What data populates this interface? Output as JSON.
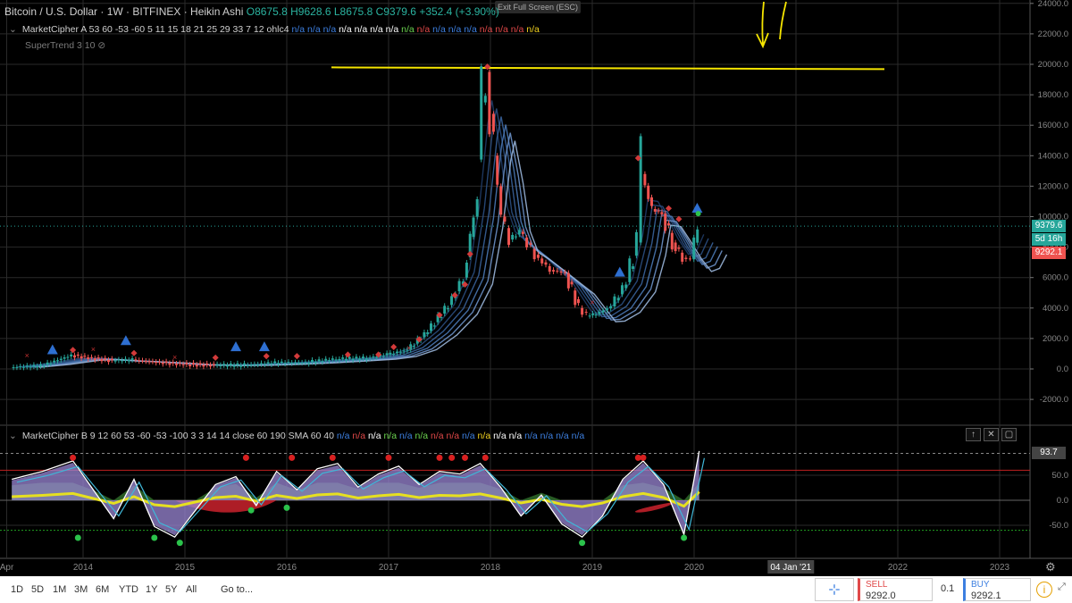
{
  "header": {
    "symbol": "Bitcoin / U.S. Dollar · 1W · BITFINEX · Heikin Ashi",
    "open": "O8675.8",
    "high": "H9628.6",
    "low": "L8675.8",
    "close": "C9379.6",
    "change": "+352.4 (+3.90%)",
    "exit_fullscreen": "Exit Full Screen (ESC)"
  },
  "indicators": {
    "a_label": "MarketCipher A 53 60 -53 -60 5 11 15 18 21 25 29 33 7 12 ohlc4",
    "a_values": [
      "n/a",
      "n/a",
      "n/a",
      "n/a",
      "n/a",
      "n/a",
      "n/a",
      "n/a",
      "n/a",
      "n/a",
      "n/a",
      "n/a",
      "n/a",
      "n/a",
      "n/a",
      "n/a"
    ],
    "a_value_colors": [
      "b",
      "b",
      "b",
      "w",
      "w",
      "w",
      "w",
      "g",
      "r",
      "b",
      "b",
      "b",
      "r",
      "r",
      "r",
      "y"
    ],
    "supertrend_label": "SuperTrend 3 10",
    "b_label": "MarketCipher B 9 12 60 53 -60 -53 -100 3 3 14 14 close 60 190 SMA 60 40",
    "b_values": [
      "n/a",
      "n/a",
      "n/a",
      "n/a",
      "n/a",
      "n/a",
      "n/a",
      "n/a",
      "n/a",
      "n/a",
      "n/a",
      "n/a",
      "n/a",
      "n/a",
      "n/a",
      "n/a"
    ],
    "b_value_colors": [
      "b",
      "r",
      "w",
      "g",
      "b",
      "g",
      "r",
      "r",
      "b",
      "y",
      "w",
      "w",
      "b",
      "b",
      "b",
      "b"
    ]
  },
  "price_tags": {
    "close": "9379.6",
    "countdown": "5d 16h",
    "bid": "9292.1",
    "osc_value": "93.7",
    "close_color": "#26a69a",
    "countdown_color": "#26a69a",
    "bid_color": "#ef5350"
  },
  "x_axis": {
    "years": [
      "Apr",
      "2014",
      "2015",
      "2016",
      "2017",
      "2018",
      "2019",
      "2020",
      "2021",
      "2022",
      "2023"
    ],
    "cursor_label": "04 Jan '21"
  },
  "timeframes": [
    "1D",
    "5D",
    "1M",
    "3M",
    "6M",
    "YTD",
    "1Y",
    "5Y",
    "All"
  ],
  "goto": "Go to...",
  "trade": {
    "sell_label": "SELL",
    "sell_price": "9292.0",
    "spread": "0.1",
    "buy_label": "BUY",
    "buy_price": "9292.1"
  },
  "colors": {
    "sell": "#e04848",
    "buy": "#3d7fe0",
    "horizontal_line": "#f5e500",
    "bull_candle": "#26a69a",
    "bear_candle": "#ef5350"
  },
  "chart_data": [
    {
      "type": "line",
      "title": "Bitcoin / U.S. Dollar · 1W · BITFINEX · Heikin Ashi",
      "ylim": [
        -2000,
        24000
      ],
      "yticks": [
        -2000,
        0,
        2000,
        4000,
        6000,
        8000,
        10000,
        12000,
        14000,
        16000,
        18000,
        20000,
        22000,
        24000
      ],
      "ytick_labels": [
        "-2000.0",
        "0.0",
        "2000.0",
        "4000.0",
        "6000.0",
        "8000.0",
        "10000.0",
        "12000.0",
        "14000.0",
        "16000.0",
        "18000.0",
        "20000.0",
        "22000.0",
        "24000.0"
      ],
      "horizontal_line": 19800,
      "series": [
        {
          "x": [
            2013.3,
            2013.6,
            2013.9,
            2014.1,
            2014.3,
            2014.5,
            2014.8,
            2015.0,
            2015.3,
            2015.6,
            2015.9,
            2016.2,
            2016.5,
            2016.8,
            2017.0,
            2017.2,
            2017.4,
            2017.6,
            2017.75,
            2017.85,
            2017.93,
            2017.97,
            2018.05,
            2018.12,
            2018.2,
            2018.3,
            2018.45,
            2018.6,
            2018.75,
            2018.88,
            2018.96,
            2019.05,
            2019.2,
            2019.35,
            2019.45,
            2019.5,
            2019.6,
            2019.7,
            2019.8,
            2019.9,
            2019.98,
            2020.05
          ],
          "values": [
            100,
            200,
            900,
            700,
            550,
            600,
            400,
            300,
            250,
            250,
            400,
            420,
            650,
            700,
            950,
            1250,
            2500,
            4200,
            6000,
            10000,
            17500,
            19500,
            14000,
            10000,
            8500,
            9000,
            7500,
            6500,
            6300,
            4000,
            3500,
            3600,
            4100,
            5700,
            8300,
            12800,
            10500,
            10200,
            8300,
            7300,
            7200,
            9379.6
          ]
        }
      ]
    },
    {
      "type": "area",
      "title": "MarketCipher B 9 12 60 53 -60 -53 -100 3 3 14 14 close 60 190 SMA 60 40",
      "ylim": [
        -100,
        100
      ],
      "yticks": [
        -50,
        0,
        50
      ],
      "ytick_labels": [
        "-50.0",
        "0.0",
        "50.0"
      ],
      "overbought": 60,
      "oversold": -60,
      "series": [
        {
          "name": "",
          "x": [
            2013.3,
            2013.6,
            2013.9,
            2014.1,
            2014.3,
            2014.5,
            2014.7,
            2014.9,
            2015.1,
            2015.3,
            2015.5,
            2015.7,
            2015.9,
            2016.1,
            2016.3,
            2016.5,
            2016.7,
            2016.9,
            2017.1,
            2017.3,
            2017.5,
            2017.7,
            2017.9,
            2018.1,
            2018.3,
            2018.5,
            2018.7,
            2018.9,
            2019.1,
            2019.3,
            2019.5,
            2019.7,
            2019.9,
            2020.05
          ],
          "values": [
            40,
            55,
            75,
            20,
            -35,
            40,
            -50,
            -70,
            -20,
            30,
            45,
            -10,
            55,
            20,
            60,
            70,
            25,
            50,
            65,
            30,
            55,
            50,
            70,
            25,
            -30,
            10,
            -45,
            -70,
            -30,
            40,
            75,
            30,
            -65,
            93.7
          ]
        }
      ]
    }
  ]
}
